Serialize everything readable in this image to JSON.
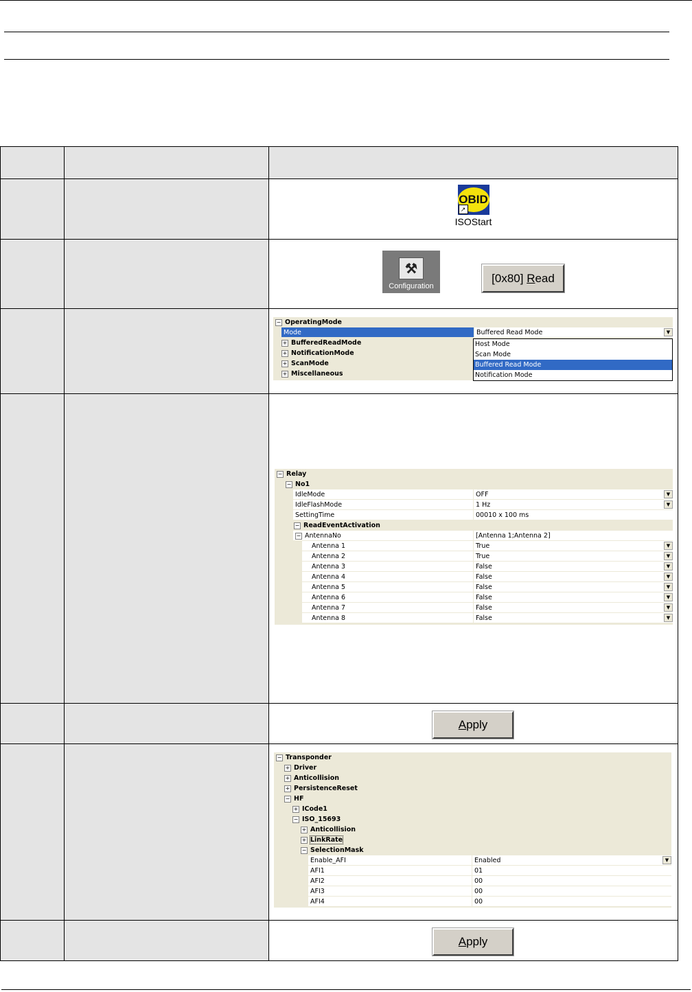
{
  "row1": {
    "icon_label": "ISOStart",
    "icon_text": "OBID"
  },
  "row2": {
    "config_label": "Configuration",
    "read_button": {
      "prefix": "[0x80] ",
      "hotkey": "R",
      "rest": "ead"
    }
  },
  "row3": {
    "category": "OperatingMode",
    "mode_label": "Mode",
    "mode_value": "Buffered Read Mode",
    "subcategories": [
      "BufferedReadMode",
      "NotificationMode",
      "ScanMode",
      "Miscellaneous"
    ],
    "options": [
      "Host Mode",
      "Scan Mode",
      "Buffered Read Mode",
      "Notification Mode"
    ],
    "selected_option": "Buffered Read Mode"
  },
  "row4": {
    "category": "Relay",
    "sub": "No1",
    "props": [
      {
        "name": "IdleMode",
        "value": "OFF",
        "dropdown": true
      },
      {
        "name": "IdleFlashMode",
        "value": "1 Hz",
        "dropdown": true
      },
      {
        "name": "SettingTime",
        "value": "00010 x 100 ms",
        "dropdown": false
      }
    ],
    "read_event": "ReadEventActivation",
    "antenna_no": {
      "name": "AntennaNo",
      "value": "[Antenna 1;Antenna 2]"
    },
    "antennas": [
      {
        "name": "Antenna 1",
        "value": "True"
      },
      {
        "name": "Antenna 2",
        "value": "True"
      },
      {
        "name": "Antenna 3",
        "value": "False"
      },
      {
        "name": "Antenna 4",
        "value": "False"
      },
      {
        "name": "Antenna 5",
        "value": "False"
      },
      {
        "name": "Antenna 6",
        "value": "False"
      },
      {
        "name": "Antenna 7",
        "value": "False"
      },
      {
        "name": "Antenna 8",
        "value": "False"
      }
    ]
  },
  "row5": {
    "apply": {
      "hotkey": "A",
      "rest": "pply"
    }
  },
  "row6": {
    "category": "Transponder",
    "tree": [
      {
        "label": "Driver",
        "level": 1,
        "box": "+"
      },
      {
        "label": "Anticollision",
        "level": 1,
        "box": "+"
      },
      {
        "label": "PersistenceReset",
        "level": 1,
        "box": "+"
      },
      {
        "label": "HF",
        "level": 1,
        "box": "-"
      },
      {
        "label": "ICode1",
        "level": 2,
        "box": "+"
      },
      {
        "label": "ISO_15693",
        "level": 2,
        "box": "-"
      },
      {
        "label": "Anticollision",
        "level": 3,
        "box": "+"
      },
      {
        "label": "LinkRate",
        "level": 3,
        "box": "+"
      },
      {
        "label": "SelectionMask",
        "level": 3,
        "box": "-"
      }
    ],
    "props": [
      {
        "name": "Enable_AFI",
        "value": "Enabled",
        "dropdown": true
      },
      {
        "name": "AFI1",
        "value": "01",
        "dropdown": false
      },
      {
        "name": "AFI2",
        "value": "00",
        "dropdown": false
      },
      {
        "name": "AFI3",
        "value": "00",
        "dropdown": false
      },
      {
        "name": "AFI4",
        "value": "00",
        "dropdown": false
      }
    ]
  },
  "row7": {
    "apply": {
      "hotkey": "A",
      "rest": "pply"
    }
  }
}
